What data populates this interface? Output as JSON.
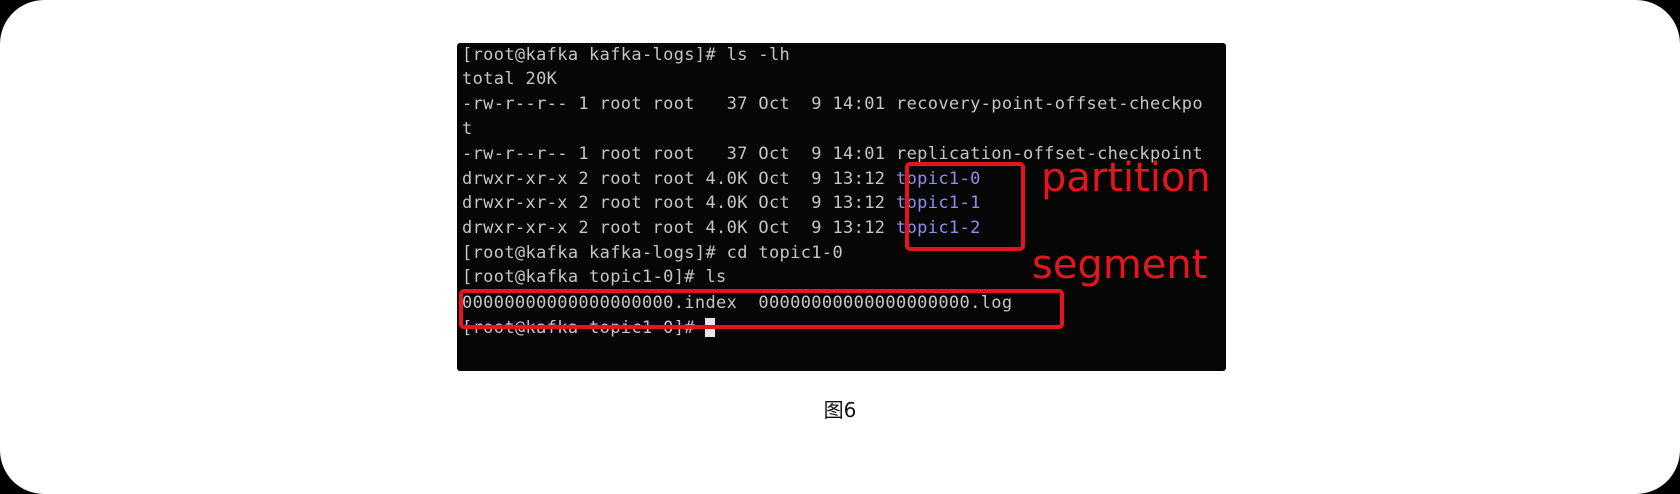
{
  "figure": {
    "caption": "图6",
    "terminal": {
      "lines": [
        "[root@kafka kafka-logs]# ls -lh",
        "total 20K",
        "-rw-r--r-- 1 root root   37 Oct  9 14:01 recovery-point-offset-checkpo",
        "t",
        "-rw-r--r-- 1 root root   37 Oct  9 14:01 replication-offset-checkpoint",
        "drwxr-xr-x 2 root root 4.0K Oct  9 13:12 ",
        "drwxr-xr-x 2 root root 4.0K Oct  9 13:12 ",
        "drwxr-xr-x 2 root root 4.0K Oct  9 13:12 ",
        "[root@kafka kafka-logs]# cd topic1-0",
        "[root@kafka topic1-0]# ls",
        "00000000000000000000.index  00000000000000000000.log",
        "[root@kafka topic1-0]# "
      ],
      "directories": [
        "topic1-0",
        "topic1-1",
        "topic1-2"
      ]
    },
    "annotations": {
      "partition_label": "partition",
      "segment_label": "segment"
    },
    "colors": {
      "annotation": "#e5141d",
      "terminal_background": "#060606",
      "terminal_text": "#c6c6c6",
      "directory_text": "#8f8ff0"
    }
  }
}
